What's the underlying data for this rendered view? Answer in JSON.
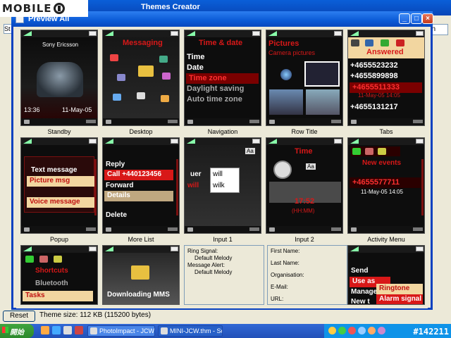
{
  "logo": {
    "text": "MOBILE",
    "suffix": "01"
  },
  "background_app": {
    "title": "Themes Creator",
    "left_field": "St",
    "right_field": "on",
    "reset_label": "Reset",
    "status_text": "Theme size: 112 KB (115200 bytes)"
  },
  "window": {
    "title": "Preview All",
    "minimize": "_",
    "maximize": "□",
    "close": "×"
  },
  "screens": [
    {
      "caption": "Standby",
      "brand": "Sony Ericsson",
      "time": "13:36",
      "date": "11-May-05"
    },
    {
      "caption": "Desktop",
      "title": "Messaging"
    },
    {
      "caption": "Navigation",
      "title": "Time & date",
      "items": [
        "Time",
        "Date",
        "Time zone",
        "Daylight saving",
        "Auto time zone"
      ]
    },
    {
      "caption": "Row Title",
      "title": "Pictures",
      "subtitle": "Camera pictures"
    },
    {
      "caption": "Tabs",
      "header": "Answered",
      "numbers": [
        "+4655523232",
        "+4655899898",
        "+4655511333",
        "+4655131217"
      ],
      "sub": "11-May-05   14:05"
    },
    {
      "caption": "Popup",
      "items": [
        "Text message",
        "Picture msg",
        "Voice message"
      ]
    },
    {
      "caption": "More List",
      "items": [
        "Reply",
        "Call +440123456",
        "Forward",
        "Details",
        "Delete"
      ]
    },
    {
      "caption": "Input 1",
      "badge": "Aa",
      "words": [
        "will",
        "wilk"
      ],
      "left_words": [
        "uer",
        "will"
      ]
    },
    {
      "caption": "Input 2",
      "title": "Time",
      "badge": "Aa",
      "value": "17:52",
      "format": "(HH:MM)"
    },
    {
      "caption": "Activity Menu",
      "header": "New events",
      "number": "+4655577711",
      "sub": "11-May-05   14:05"
    },
    {
      "items": [
        "Shortcuts",
        "Bluetooth",
        "Tasks"
      ]
    },
    {
      "title": "Downloading MMS"
    },
    {
      "items": [
        "Send",
        "Use as",
        "Manage",
        "New t"
      ],
      "popup": [
        "Ringtone",
        "Alarm signal"
      ]
    }
  ],
  "info_left": {
    "lines": [
      "Ring Signal:",
      "Default Melody",
      "Message Alert:",
      "Default Melody"
    ]
  },
  "info_right": {
    "lines": [
      "First Name:",
      "Last Name:",
      "Organisation:",
      "E-Mail:",
      "URL:"
    ]
  },
  "taskbar": {
    "start": "開始",
    "tasks": [
      "PhotoImpact - JCW_G...",
      "MINI-JCW.thm - Son..."
    ],
    "watermark": "#142211"
  }
}
